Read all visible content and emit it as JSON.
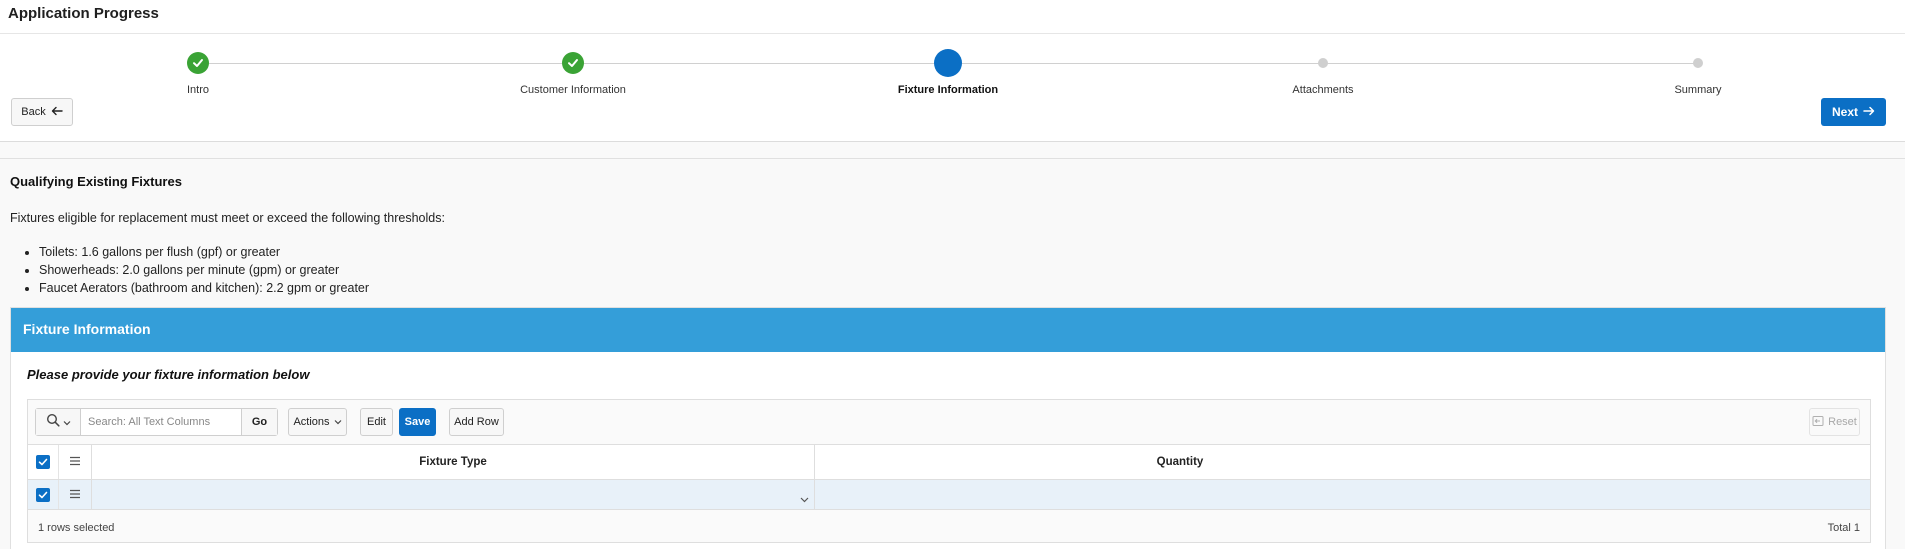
{
  "app": {
    "title": "Application Progress"
  },
  "progress": {
    "steps": [
      {
        "label": "Intro",
        "state": "complete"
      },
      {
        "label": "Customer Information",
        "state": "complete"
      },
      {
        "label": "Fixture Information",
        "state": "current"
      },
      {
        "label": "Attachments",
        "state": "upcoming"
      },
      {
        "label": "Summary",
        "state": "upcoming"
      }
    ],
    "back_label": "Back",
    "next_label": "Next"
  },
  "content": {
    "heading": "Qualifying Existing Fixtures",
    "intro": "Fixtures eligible for replacement must meet or exceed the following thresholds:",
    "thresholds": [
      "Toilets: 1.6 gallons per flush (gpf) or greater",
      "Showerheads: 2.0 gallons per minute (gpm) or greater",
      "Faucet Aerators (bathroom and kitchen): 2.2 gpm or greater"
    ]
  },
  "panel": {
    "title": "Fixture Information",
    "instructions": "Please provide your fixture information below"
  },
  "grid": {
    "search_placeholder": "Search: All Text Columns",
    "go_label": "Go",
    "actions_label": "Actions",
    "edit_label": "Edit",
    "save_label": "Save",
    "add_row_label": "Add Row",
    "reset_label": "Reset",
    "columns": [
      "Fixture Type",
      "Quantity"
    ],
    "rows": [
      {
        "fixture_type": "",
        "quantity": "",
        "selected": true
      }
    ],
    "selection_status": "1 rows selected",
    "total": "Total 1"
  },
  "colors": {
    "accent": "#0b6fc5",
    "complete": "#3aa335",
    "panel_header": "#349ed9",
    "selected_row": "#e8f1f9"
  }
}
